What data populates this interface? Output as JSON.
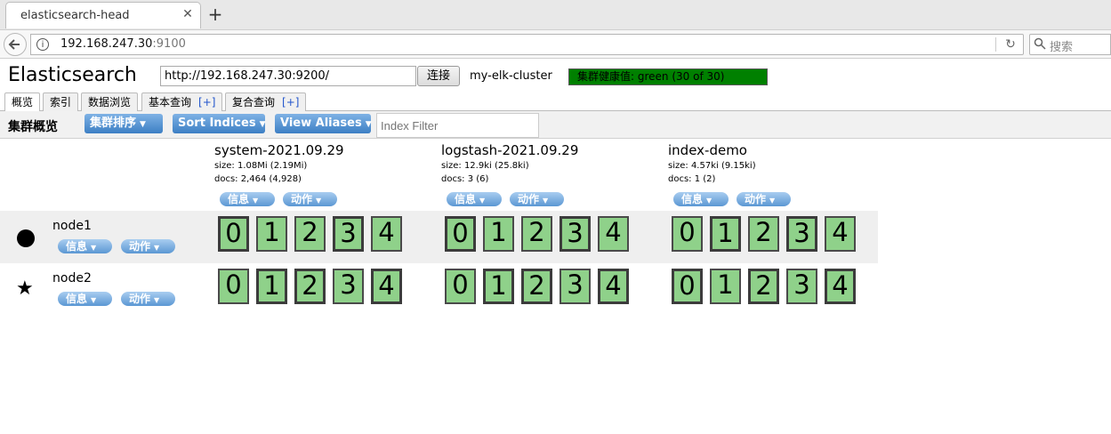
{
  "browser": {
    "tab_title": "elasticsearch-head",
    "tab_close": "✕",
    "new_tab": "+",
    "url_host": "192.168.247.30",
    "url_port": ":9100",
    "search_placeholder": "搜索"
  },
  "header": {
    "app_title": "Elasticsearch",
    "connect_url": "http://192.168.247.30:9200/",
    "connect_button": "连接",
    "cluster_name": "my-elk-cluster",
    "health_text": "集群健康值: green (30 of 30)",
    "health_color": "#008000"
  },
  "app_tabs": [
    {
      "label": "概览",
      "plus": ""
    },
    {
      "label": "索引",
      "plus": ""
    },
    {
      "label": "数据浏览",
      "plus": ""
    },
    {
      "label": "基本查询",
      "plus": "[+]"
    },
    {
      "label": "复合查询",
      "plus": "[+]"
    }
  ],
  "toolbar": {
    "title": "集群概览",
    "sort_cluster": "集群排序",
    "sort_indices": "Sort Indices",
    "view_aliases": "View Aliases",
    "index_filter_placeholder": "Index Filter"
  },
  "indices": [
    {
      "name": "system-2021.09.29",
      "size": "size: 1.08Mi (2.19Mi)",
      "docs": "docs: 2,464 (4,928)",
      "info": "信息",
      "action": "动作"
    },
    {
      "name": "logstash-2021.09.29",
      "size": "size: 12.9ki (25.8ki)",
      "docs": "docs: 3 (6)",
      "info": "信息",
      "action": "动作"
    },
    {
      "name": "index-demo",
      "size": "size: 4.57ki (9.15ki)",
      "docs": "docs: 1 (2)",
      "info": "信息",
      "action": "动作"
    }
  ],
  "nodes": [
    {
      "name": "node1",
      "role_icon": "master-dot-icon",
      "info": "信息",
      "action": "动作",
      "shards": [
        [
          "0",
          "1",
          "2",
          "3",
          "4"
        ],
        [
          "0",
          "1",
          "2",
          "3",
          "4"
        ],
        [
          "0",
          "1",
          "2",
          "3",
          "4"
        ]
      ]
    },
    {
      "name": "node2",
      "role_icon": "star-icon",
      "info": "信息",
      "action": "动作",
      "shards": [
        [
          "0",
          "1",
          "2",
          "3",
          "4"
        ],
        [
          "0",
          "1",
          "2",
          "3",
          "4"
        ],
        [
          "0",
          "1",
          "2",
          "3",
          "4"
        ]
      ]
    }
  ],
  "colors": {
    "shard_fill": "#8fd18a",
    "button_blue": "#3c7fc4"
  }
}
